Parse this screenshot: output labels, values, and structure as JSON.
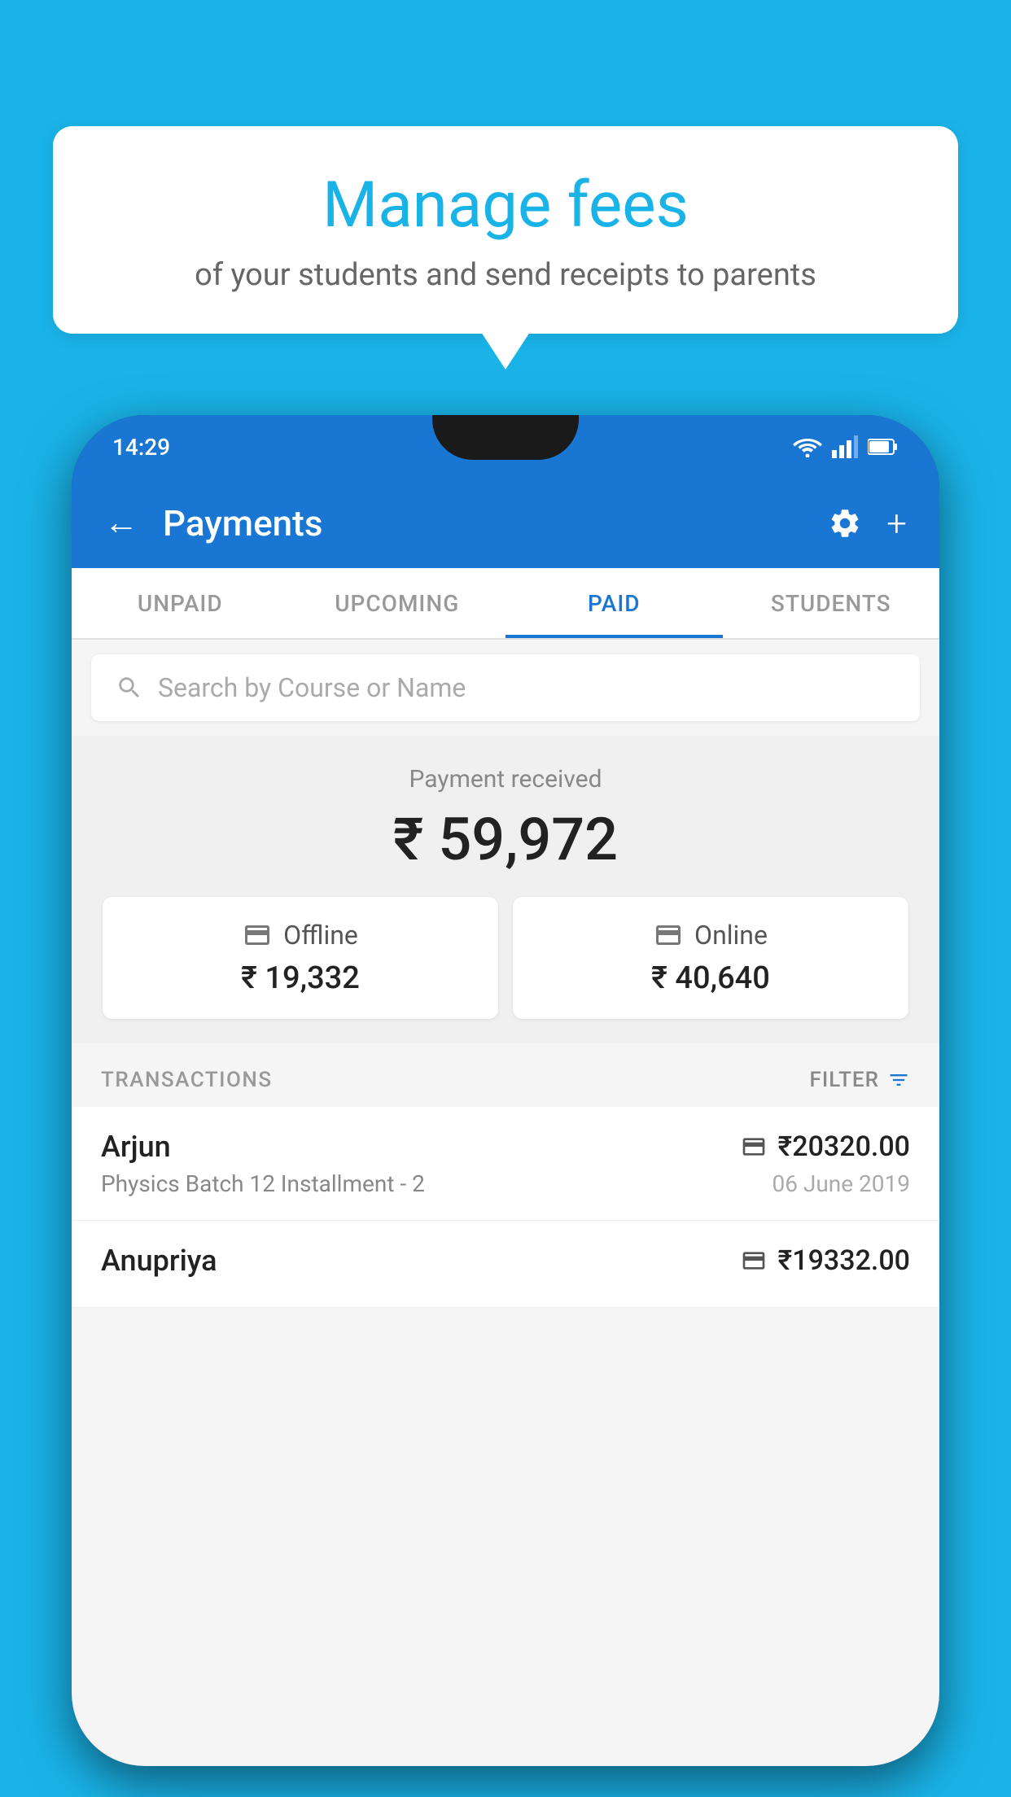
{
  "background_color": "#1ab3e8",
  "speech_bubble": {
    "title": "Manage fees",
    "subtitle": "of your students and send receipts to parents"
  },
  "status_bar": {
    "time": "14:29"
  },
  "header": {
    "title": "Payments",
    "back_label": "←",
    "settings_label": "⚙",
    "add_label": "+"
  },
  "tabs": [
    {
      "label": "UNPAID",
      "active": false
    },
    {
      "label": "UPCOMING",
      "active": false
    },
    {
      "label": "PAID",
      "active": true
    },
    {
      "label": "STUDENTS",
      "active": false
    }
  ],
  "search": {
    "placeholder": "Search by Course or Name"
  },
  "payment_received": {
    "label": "Payment received",
    "amount": "₹ 59,972",
    "offline": {
      "label": "Offline",
      "amount": "₹ 19,332"
    },
    "online": {
      "label": "Online",
      "amount": "₹ 40,640"
    }
  },
  "transactions": {
    "header_label": "TRANSACTIONS",
    "filter_label": "FILTER",
    "rows": [
      {
        "name": "Arjun",
        "course": "Physics Batch 12 Installment - 2",
        "amount": "₹20320.00",
        "date": "06 June 2019",
        "icon_type": "card"
      },
      {
        "name": "Anupriya",
        "course": "",
        "amount": "₹19332.00",
        "date": "",
        "icon_type": "cash"
      }
    ]
  }
}
